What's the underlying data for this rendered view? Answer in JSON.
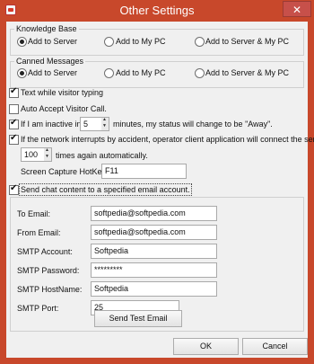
{
  "window": {
    "title": "Other Settings"
  },
  "knowledge_base": {
    "label": "Knowledge Base",
    "options": [
      "Add to Server",
      "Add to My PC",
      "Add to Server & My PC"
    ],
    "selected": 0
  },
  "canned_messages": {
    "label": "Canned Messages",
    "options": [
      "Add to Server",
      "Add to My PC",
      "Add to Server & My PC"
    ],
    "selected": 0
  },
  "options": {
    "text_while_typing": {
      "label": "Text while visitor typing",
      "checked": true
    },
    "auto_accept": {
      "label": "Auto Accept Visitor Call.",
      "checked": false
    },
    "inactive": {
      "prefix": "If I am inactive in",
      "value": "5",
      "suffix": "minutes, my status will change to be \"Away\".",
      "checked": true
    },
    "reconnect": {
      "label": "If the network interrupts by accident, operator client application will connect the server",
      "value": "100",
      "suffix": "times again automatically.",
      "checked": true
    },
    "hotkey": {
      "label": "Screen Capture HotKey:",
      "value": "F11"
    },
    "send_email": {
      "label": "Send chat content to a specified email account.",
      "checked": true
    }
  },
  "email": {
    "to_label": "To Email:",
    "to_value": "softpedia@softpedia.com",
    "from_label": "From Email:",
    "from_value": "softpedia@softpedia.com",
    "account_label": "SMTP Account:",
    "account_value": "Softpedia",
    "password_label": "SMTP Password:",
    "password_value": "*********",
    "host_label": "SMTP HostName:",
    "host_value": "Softpedia",
    "port_label": "SMTP Port:",
    "port_value": "25",
    "test_button": "Send Test Email"
  },
  "footer": {
    "ok": "OK",
    "cancel": "Cancel"
  },
  "colors": {
    "titlebar": "#c8482b",
    "client": "#f0f0f0",
    "close": "#c7504a"
  }
}
